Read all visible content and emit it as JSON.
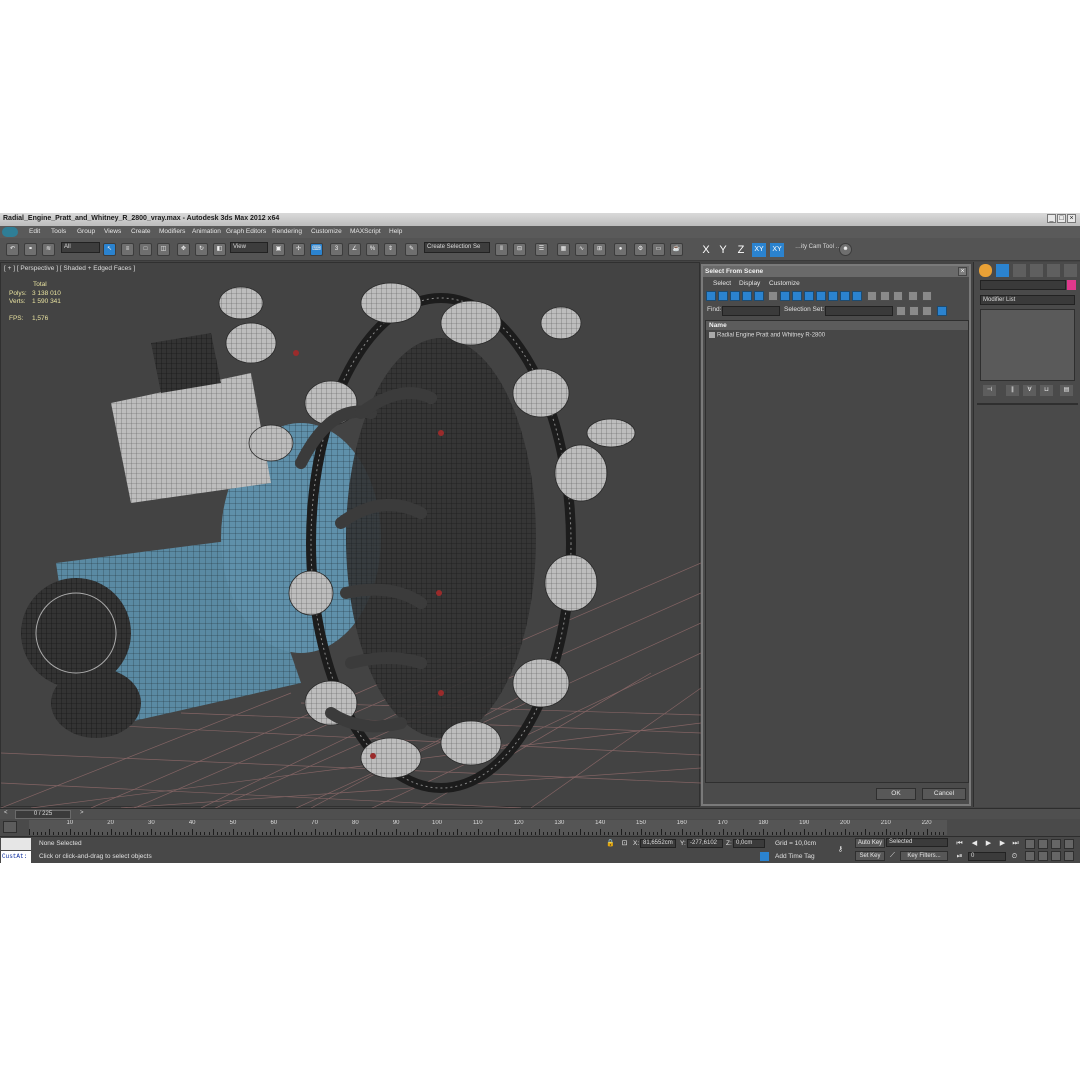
{
  "window": {
    "title": "Radial_Engine_Pratt_and_Whitney_R_2800_vray.max - Autodesk 3ds Max  2012 x64"
  },
  "menu": [
    "Edit",
    "Tools",
    "Group",
    "Views",
    "Create",
    "Modifiers",
    "Animation",
    "Graph Editors",
    "Rendering",
    "Customize",
    "MAXScript",
    "Help"
  ],
  "toolbar": {
    "selection_filter": "All",
    "reference_coord": "View",
    "create_selection_set": "Create Selection Se",
    "snap_label": "3",
    "axis_x": "X",
    "axis_y": "Y",
    "axis_z": "Z",
    "axis_xy": "XY",
    "axis_xy2": "XY",
    "cam_tool": "…ity Cam Tool …"
  },
  "viewport": {
    "label": "[ + ] [ Perspective ] [ Shaded + Edged Faces ]",
    "stats": {
      "total_label": "Total",
      "polys_label": "Polys:",
      "polys_value": "3 138 010",
      "verts_label": "Verts:",
      "verts_value": "1 590 341",
      "fps_label": "FPS:",
      "fps_value": "1,576"
    }
  },
  "dialog": {
    "title": "Select From Scene",
    "menu": [
      "Select",
      "Display",
      "Customize"
    ],
    "find_label": "Find:",
    "selection_set_label": "Selection Set:",
    "column_name": "Name",
    "items": [
      "Radial Engine Pratt and Whitney R-2800"
    ],
    "ok": "OK",
    "cancel": "Cancel"
  },
  "command_panel": {
    "modifier_list": "Modifier List",
    "color_swatch": "#e0388c"
  },
  "time_slider": {
    "frame": "0 / 225",
    "prev": "<",
    "next": ">"
  },
  "trackbar": {
    "ticks": [
      10,
      20,
      30,
      40,
      50,
      60,
      70,
      80,
      90,
      100,
      110,
      120,
      130,
      140,
      150,
      160,
      170,
      180,
      190,
      200,
      210,
      220
    ]
  },
  "status": {
    "maxscript": "CustAt:",
    "selection": "None Selected",
    "prompt": "Click or click-and-drag to select objects",
    "x_label": "X:",
    "x_value": "81,6552cm",
    "y_label": "Y:",
    "y_value": "-277,6102",
    "z_label": "Z:",
    "z_value": "0,0cm",
    "grid": "Grid = 10,0cm",
    "add_time_tag": "Add Time Tag",
    "auto_key": "Auto Key",
    "set_key": "Set Key",
    "selected": "Selected",
    "key_filters": "Key Filters...",
    "frame_value": "0"
  },
  "colors": {
    "engine_body": "#5a8aa3",
    "wire": "#cfcfcf",
    "grid": "#8a6d6d",
    "accent_blue": "#2b83cf"
  }
}
